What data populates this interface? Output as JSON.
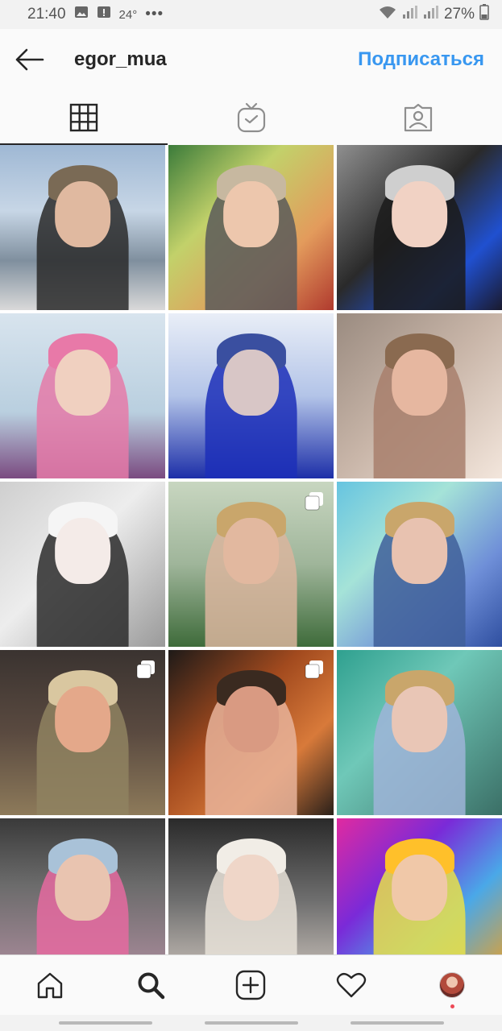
{
  "status_bar": {
    "time": "21:40",
    "temperature": "24°",
    "more": "•••",
    "battery": "27%"
  },
  "header": {
    "username": "egor_mua",
    "follow_label": "Подписаться"
  },
  "tabs": [
    {
      "name": "grid",
      "icon": "grid-icon",
      "active": true
    },
    {
      "name": "igtv",
      "icon": "igtv-icon",
      "active": false
    },
    {
      "name": "tagged",
      "icon": "tagged-icon",
      "active": false
    }
  ],
  "posts": [
    {
      "bg": "linear-gradient(180deg,#9fb8d4 0%,#c7d6e6 40%,#7f8f9e 70%,#d9d9d9 100%)",
      "figure": "#2a2a2a",
      "face": "#e0b9a0",
      "hair": "#7a6a55",
      "multi": false
    },
    {
      "bg": "linear-gradient(135deg,#3b7b3a 0%,#c2d16a 35%,#e39b5c 70%,#b03a2e 100%)",
      "figure": "#5a5a5a",
      "face": "#edc7ad",
      "hair": "#c7b8a0",
      "multi": false
    },
    {
      "bg": "linear-gradient(135deg,#8f8f8f 0%,#2a2a2a 45%,#2050d0 75%,#1a1a2e 100%)",
      "figure": "#1b1b1b",
      "face": "#f1d2c4",
      "hair": "#cfcfcf",
      "multi": false
    },
    {
      "bg": "linear-gradient(180deg,#d8e4ee 0%,#b9cfdf 60%,#7a4a80 100%)",
      "figure": "#e57aa8",
      "face": "#f0d0c0",
      "hair": "#e879a8",
      "multi": false
    },
    {
      "bg": "linear-gradient(180deg,#e9eef7 0%,#b3c4e8 50%,#1d2fa8 100%)",
      "figure": "#1c2fb8",
      "face": "#d8c6c6",
      "hair": "#3a4fa0",
      "multi": false
    },
    {
      "bg": "linear-gradient(135deg,#9a8b80 0%,#c9b6a9 50%,#f3e6dc 100%)",
      "figure": "#a87f6c",
      "face": "#e6b7a0",
      "hair": "#8a6a50",
      "multi": false
    },
    {
      "bg": "linear-gradient(135deg,#cfcfcf 0%,#ededed 45%,#9a9a9a 100%)",
      "figure": "#2b2b2b",
      "face": "#f4ebe8",
      "hair": "#f5f5f5",
      "multi": false
    },
    {
      "bg": "linear-gradient(180deg,#c8d6c0 0%,#9fb59a 50%,#3e6b3a 100%)",
      "figure": "#d9b59e",
      "face": "#e2b89f",
      "hair": "#c9a66b",
      "multi": true
    },
    {
      "bg": "linear-gradient(135deg,#66c4e0 0%,#a5e3d8 35%,#6f8fd8 70%,#2f4fa0 100%)",
      "figure": "#3f5f9a",
      "face": "#e8c2b0",
      "hair": "#c9a66b",
      "multi": false
    },
    {
      "bg": "linear-gradient(180deg,#3a3330 0%,#5a4a40 50%,#8d7a5a 100%)",
      "figure": "#8f8260",
      "face": "#e4a88a",
      "hair": "#d9c7a0",
      "multi": true
    },
    {
      "bg": "linear-gradient(135deg,#1e1a18 0%,#a24a1e 40%,#d87a3a 70%,#2a201a 100%)",
      "figure": "#e7b39a",
      "face": "#d99a82",
      "hair": "#3a2a20",
      "multi": true
    },
    {
      "bg": "linear-gradient(135deg,#2fa08f 0%,#6fc8b8 40%,#3b6f66 100%)",
      "figure": "#9fb4d8",
      "face": "#e9c6b6",
      "hair": "#c9a66b",
      "multi": false
    },
    {
      "bg": "linear-gradient(180deg,#3a3a3a 0%,#6b6b6b 40%,#b08fa0 100%)",
      "figure": "#e56aa0",
      "face": "#e9c4b0",
      "hair": "#a9c2d8",
      "multi": false
    },
    {
      "bg": "linear-gradient(180deg,#2a2a2a 0%,#6f6f6f 50%,#cfc6be 100%)",
      "figure": "#e8e2d8",
      "face": "#efd6c8",
      "hair": "#f1ede6",
      "multi": false
    },
    {
      "bg": "linear-gradient(135deg,#e02aa0 0%,#7a2ad8 35%,#4aa8e8 65%,#f0a020 100%)",
      "figure": "#e8e04a",
      "face": "#f0c8a8",
      "hair": "#ffc02a",
      "multi": false
    }
  ],
  "bottom_nav": [
    {
      "name": "home",
      "icon": "home-icon"
    },
    {
      "name": "search",
      "icon": "search-icon"
    },
    {
      "name": "add",
      "icon": "add-post-icon"
    },
    {
      "name": "activity",
      "icon": "heart-icon"
    },
    {
      "name": "profile",
      "icon": "avatar"
    }
  ],
  "colors": {
    "accent": "#3897f0",
    "text": "#262626",
    "notify_dot": "#ed4956"
  }
}
